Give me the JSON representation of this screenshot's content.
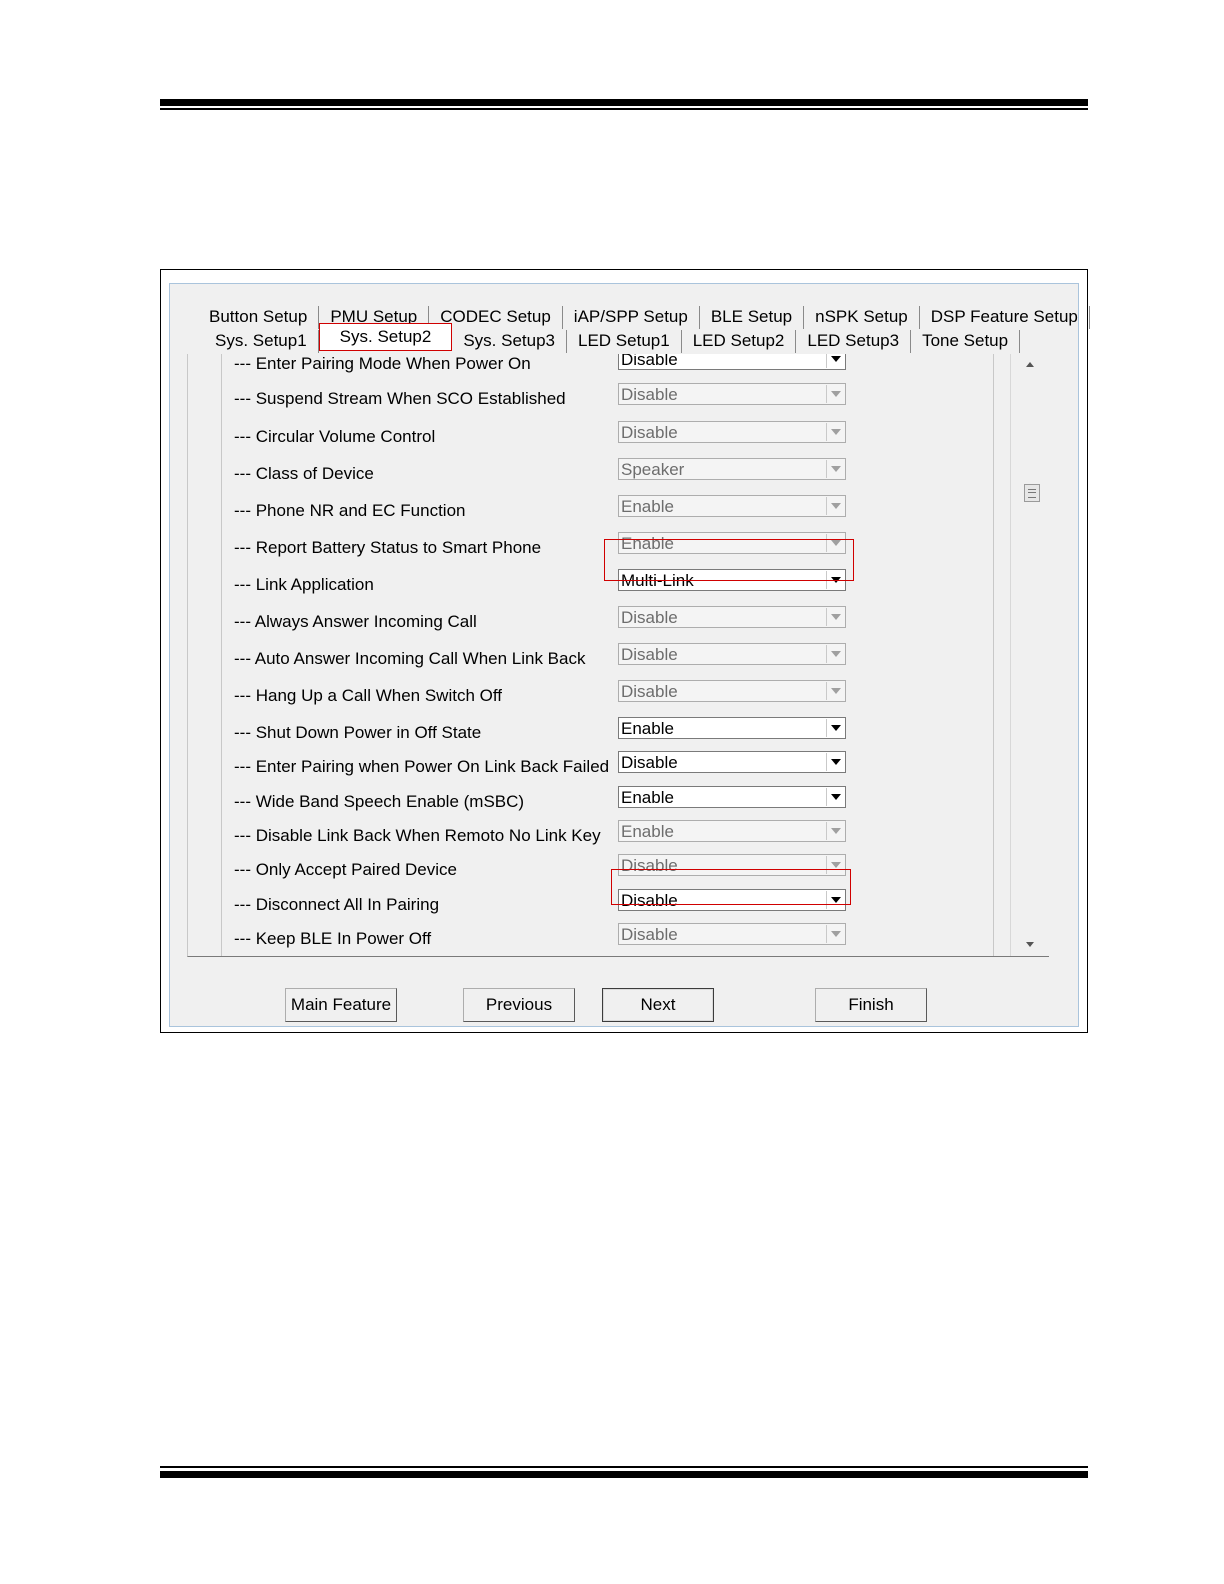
{
  "tabs": {
    "row1": [
      "Button Setup",
      "PMU Setup",
      "CODEC Setup",
      "iAP/SPP Setup",
      "BLE Setup",
      "nSPK Setup",
      "DSP Feature Setup"
    ],
    "row2": [
      "Sys. Setup1",
      "Sys. Setup2",
      "Sys. Setup3",
      "LED Setup1",
      "LED Setup2",
      "LED Setup3",
      "Tone Setup"
    ],
    "active": "Sys. Setup2"
  },
  "settings": [
    {
      "label": "--- Enter Pairing Mode When Power On",
      "value": "Disable",
      "enabled": true
    },
    {
      "label": "--- Suspend Stream When SCO Established",
      "value": "Disable",
      "enabled": false
    },
    {
      "label": "--- Circular Volume Control",
      "value": "Disable",
      "enabled": false
    },
    {
      "label": "--- Class of Device",
      "value": "Speaker",
      "enabled": false
    },
    {
      "label": "--- Phone NR and EC Function",
      "value": "Enable",
      "enabled": false
    },
    {
      "label": "--- Report Battery Status to Smart Phone",
      "value": "Enable",
      "enabled": false
    },
    {
      "label": "--- Link Application",
      "value": "Multi-Link",
      "enabled": true
    },
    {
      "label": "--- Always Answer Incoming Call",
      "value": "Disable",
      "enabled": false
    },
    {
      "label": "--- Auto Answer Incoming Call When Link Back",
      "value": "Disable",
      "enabled": false
    },
    {
      "label": "--- Hang Up a Call When Switch Off",
      "value": "Disable",
      "enabled": false
    },
    {
      "label": "--- Shut Down Power in Off State",
      "value": "Enable",
      "enabled": true
    },
    {
      "label": "--- Enter Pairing when Power On Link Back Failed",
      "value": "Disable",
      "enabled": true
    },
    {
      "label": "--- Wide Band Speech Enable (mSBC)",
      "value": "Enable",
      "enabled": true
    },
    {
      "label": "--- Disable Link Back When Remoto No Link Key",
      "value": "Enable",
      "enabled": false
    },
    {
      "label": "--- Only Accept Paired Device",
      "value": "Disable",
      "enabled": false
    },
    {
      "label": "--- Disconnect All In Pairing",
      "value": "Disable",
      "enabled": true
    },
    {
      "label": "--- Keep BLE In Power Off",
      "value": "Disable",
      "enabled": false
    }
  ],
  "buttons": {
    "main_feature": "Main Feature",
    "previous": "Previous",
    "next": "Next",
    "finish": "Finish"
  }
}
